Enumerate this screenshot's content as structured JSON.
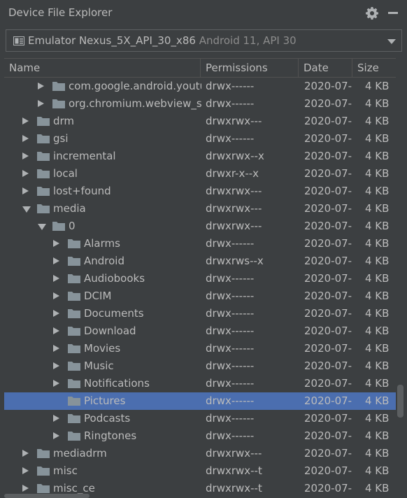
{
  "window": {
    "title": "Device File Explorer"
  },
  "device": {
    "name": "Emulator Nexus_5X_API_30_x86",
    "detail": "Android 11, API 30"
  },
  "columns": {
    "name": "Name",
    "permissions": "Permissions",
    "date": "Date",
    "size": "Size"
  },
  "rows": [
    {
      "name": "com.google.android.youtube",
      "perm": "drwx------",
      "date": "2020-07-",
      "size": "4 KB",
      "level": 2,
      "state": "collapsed",
      "selected": false
    },
    {
      "name": "org.chromium.webview_s",
      "perm": "drwx------",
      "date": "2020-07-",
      "size": "4 KB",
      "level": 2,
      "state": "collapsed",
      "selected": false
    },
    {
      "name": "drm",
      "perm": "drwxrwx---",
      "date": "2020-07-",
      "size": "4 KB",
      "level": 1,
      "state": "collapsed",
      "selected": false
    },
    {
      "name": "gsi",
      "perm": "drwx------",
      "date": "2020-07-",
      "size": "4 KB",
      "level": 1,
      "state": "collapsed",
      "selected": false
    },
    {
      "name": "incremental",
      "perm": "drwxrwx--x",
      "date": "2020-07-",
      "size": "4 KB",
      "level": 1,
      "state": "collapsed",
      "selected": false
    },
    {
      "name": "local",
      "perm": "drwxr-x--x",
      "date": "2020-07-",
      "size": "4 KB",
      "level": 1,
      "state": "collapsed",
      "selected": false
    },
    {
      "name": "lost+found",
      "perm": "drwxrwx---",
      "date": "2020-07-",
      "size": "4 KB",
      "level": 1,
      "state": "collapsed",
      "selected": false
    },
    {
      "name": "media",
      "perm": "drwxrwx---",
      "date": "2020-07-",
      "size": "4 KB",
      "level": 1,
      "state": "expanded",
      "selected": false
    },
    {
      "name": "0",
      "perm": "drwxrwx---",
      "date": "2020-07-",
      "size": "4 KB",
      "level": 2,
      "state": "expanded",
      "selected": false
    },
    {
      "name": "Alarms",
      "perm": "drwx------",
      "date": "2020-07-",
      "size": "4 KB",
      "level": 3,
      "state": "collapsed",
      "selected": false
    },
    {
      "name": "Android",
      "perm": "drwxrws--x",
      "date": "2020-07-",
      "size": "4 KB",
      "level": 3,
      "state": "collapsed",
      "selected": false
    },
    {
      "name": "Audiobooks",
      "perm": "drwx------",
      "date": "2020-07-",
      "size": "4 KB",
      "level": 3,
      "state": "collapsed",
      "selected": false
    },
    {
      "name": "DCIM",
      "perm": "drwx------",
      "date": "2020-07-",
      "size": "4 KB",
      "level": 3,
      "state": "collapsed",
      "selected": false
    },
    {
      "name": "Documents",
      "perm": "drwx------",
      "date": "2020-07-",
      "size": "4 KB",
      "level": 3,
      "state": "collapsed",
      "selected": false
    },
    {
      "name": "Download",
      "perm": "drwx------",
      "date": "2020-07-",
      "size": "4 KB",
      "level": 3,
      "state": "collapsed",
      "selected": false
    },
    {
      "name": "Movies",
      "perm": "drwx------",
      "date": "2020-07-",
      "size": "4 KB",
      "level": 3,
      "state": "collapsed",
      "selected": false
    },
    {
      "name": "Music",
      "perm": "drwx------",
      "date": "2020-07-",
      "size": "4 KB",
      "level": 3,
      "state": "collapsed",
      "selected": false
    },
    {
      "name": "Notifications",
      "perm": "drwx------",
      "date": "2020-07-",
      "size": "4 KB",
      "level": 3,
      "state": "collapsed",
      "selected": false
    },
    {
      "name": "Pictures",
      "perm": "drwx------",
      "date": "2020-07-",
      "size": "4 KB",
      "level": 3,
      "state": "none",
      "selected": true
    },
    {
      "name": "Podcasts",
      "perm": "drwx------",
      "date": "2020-07-",
      "size": "4 KB",
      "level": 3,
      "state": "collapsed",
      "selected": false
    },
    {
      "name": "Ringtones",
      "perm": "drwx------",
      "date": "2020-07-",
      "size": "4 KB",
      "level": 3,
      "state": "collapsed",
      "selected": false
    },
    {
      "name": "mediadrm",
      "perm": "drwxrwx---",
      "date": "2020-07-",
      "size": "4 KB",
      "level": 1,
      "state": "collapsed",
      "selected": false
    },
    {
      "name": "misc",
      "perm": "drwxrwx--t",
      "date": "2020-07-",
      "size": "4 KB",
      "level": 1,
      "state": "collapsed",
      "selected": false
    },
    {
      "name": "misc_ce",
      "perm": "drwxrwx--t",
      "date": "2020-07-",
      "size": "4 KB",
      "level": 1,
      "state": "collapsed",
      "selected": false
    }
  ],
  "colors": {
    "background": "#3c3f41",
    "selection": "#4b6eaf",
    "folder": "#87939a",
    "text": "#bbbbbb"
  },
  "icons": {
    "settings": "gear-icon",
    "hide": "minimize-icon",
    "device": "emulator-device-icon",
    "folder": "folder-icon"
  }
}
